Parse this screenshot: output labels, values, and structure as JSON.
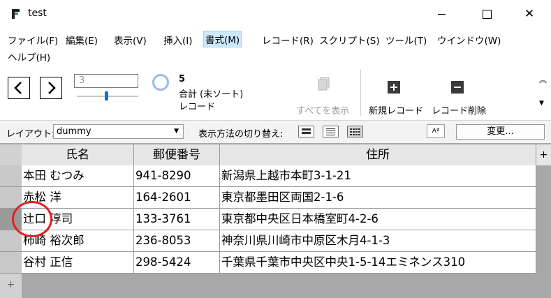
{
  "window": {
    "title": "test"
  },
  "menu": [
    "ファイル(F)",
    "編集(E)",
    "表示(V)",
    "挿入(I)",
    "書式(M)",
    "レコード(R)",
    "スクリプト(S)",
    "ツール(T)",
    "ウインドウ(W)",
    "ヘルプ(H)"
  ],
  "toolbar": {
    "record_number": "3",
    "record_count": "5",
    "total_label": "合計 (未ソート)",
    "record_label": "レコード",
    "show_all_label": "すべてを表示",
    "new_record_label": "新規レコード",
    "delete_record_label": "レコード削除"
  },
  "layout_bar": {
    "layout_label": "レイアウト:",
    "layout_value": "dummy",
    "view_switch_label": "表示方法の切り替え:",
    "aa_label": "Aª",
    "change_label": "変更..."
  },
  "table": {
    "headers": [
      "氏名",
      "郵便番号",
      "住所"
    ],
    "rows": [
      [
        "本田 むつみ",
        "941-8290",
        "新潟県上越市本町3-1-21"
      ],
      [
        "赤松 洋",
        "164-2601",
        "東京都墨田区両国2-1-6"
      ],
      [
        "辻口 淳司",
        "133-3761",
        "東京都中央区日本橋室町4-2-6"
      ],
      [
        "柿崎 裕次郎",
        "236-8053",
        "神奈川県川崎市中原区木月4-1-3"
      ],
      [
        "谷村 正信",
        "298-5424",
        "千葉県千葉市中央区中央1-5-14エミネンス310"
      ]
    ],
    "selected_row": 2,
    "plus_label": "+"
  },
  "colors": {
    "accent": "#0078d7",
    "selection": "#cce8ff",
    "annotation": "#e0201f"
  }
}
